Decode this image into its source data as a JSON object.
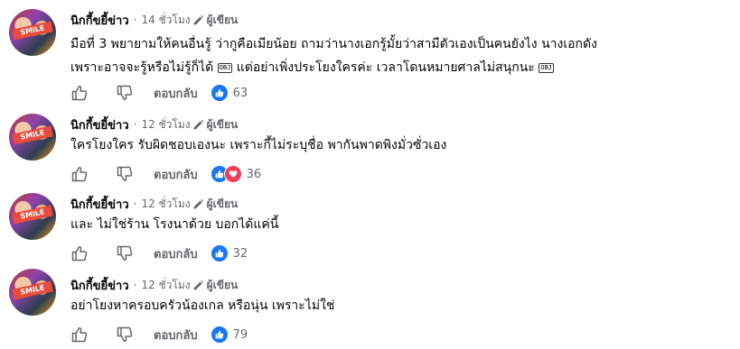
{
  "comments": [
    {
      "author": "นิกกี้ขยี้ข่าว",
      "time": "14 ชั่วโมง",
      "role": "ผู้เขียน",
      "line1": "มือที่ 3 พยายามให้คนอื่นรู้ ว่ากูคือเมียน้อย ถามว่านางเอกรู้มั้ยว่าสามีตัวเองเป็นคนยังไง นางเอกดัง",
      "line2a": "เพราะอาจจะรู้หรือไม่รู้ก็ได้",
      "line2b": "แต่อย่าเพิ่งประโยงใครค่ะ เวลาโดนหมายศาลไม่สนุกนะ",
      "reply_label": "ตอบกลับ",
      "reaction_count": "63"
    },
    {
      "author": "นิกกี้ขยี้ข่าว",
      "time": "12 ชั่วโมง",
      "role": "ผู้เขียน",
      "line1": "ใครโยงใคร รับผิดชอบเองนะ เพราะกี้ไม่ระบุชื่อ พากันพาดพิงมั่วซั่วเอง",
      "reply_label": "ตอบกลับ",
      "reaction_count": "36"
    },
    {
      "author": "นิกกี้ขยี้ข่าว",
      "time": "12 ชั่วโมง",
      "role": "ผู้เขียน",
      "line1": "และ ไม่ใช่ร้าน โรงนาด้วย บอกได้แค่นี้",
      "reply_label": "ตอบกลับ",
      "reaction_count": "32"
    },
    {
      "author": "นิกกี้ขยี้ข่าว",
      "time": "12 ชั่วโมง",
      "role": "ผู้เขียน",
      "line1": "อย่าโยงหาครอบครัวน้องเกล หรือนุ่น เพราะไม่ใช่",
      "reply_label": "ตอบกลับ",
      "reaction_count": "79"
    }
  ],
  "emoji_box": "OBJ",
  "avatar_text": "SMILE",
  "colors": {
    "like": "#1877f2",
    "love": "#f33e58",
    "meta": "#65676b",
    "text": "#050505"
  },
  "icons": [
    "thumb-up-icon",
    "thumb-down-icon",
    "pencil-icon",
    "like-reaction-icon",
    "love-reaction-icon"
  ]
}
